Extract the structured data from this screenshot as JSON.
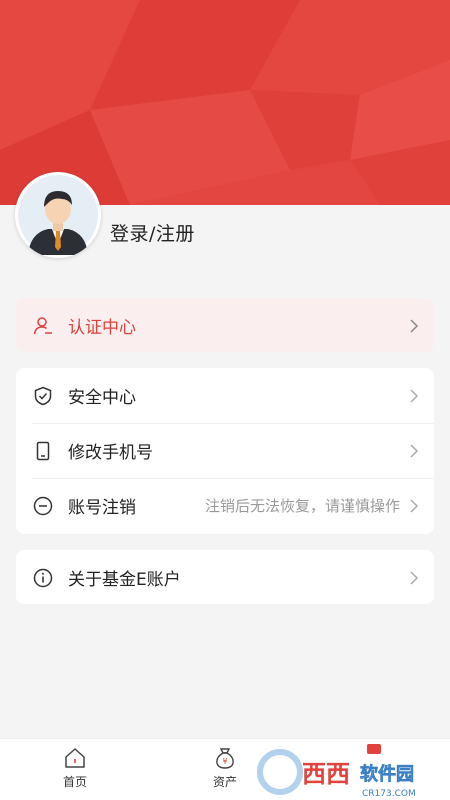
{
  "profile": {
    "login_label": "登录/注册"
  },
  "cert": {
    "label": "认证中心",
    "icon": "user-check-icon",
    "accent": "#d9443f"
  },
  "security": {
    "items": [
      {
        "label": "安全中心",
        "hint": "",
        "icon": "shield-check-icon"
      },
      {
        "label": "修改手机号",
        "hint": "",
        "icon": "phone-icon"
      },
      {
        "label": "账号注销",
        "hint": "注销后无法恢复，请谨慎操作",
        "icon": "minus-circle-icon"
      }
    ]
  },
  "about": {
    "label": "关于基金E账户",
    "icon": "info-circle-icon"
  },
  "tabbar": {
    "tabs": [
      {
        "label": "首页",
        "icon": "home-icon"
      },
      {
        "label": "资产",
        "icon": "money-bag-icon"
      }
    ]
  },
  "watermark": {
    "text": "西西软件园",
    "sub": "CR173.COM"
  },
  "colors": {
    "header": "#e2423c",
    "background": "#f4f4f4"
  }
}
